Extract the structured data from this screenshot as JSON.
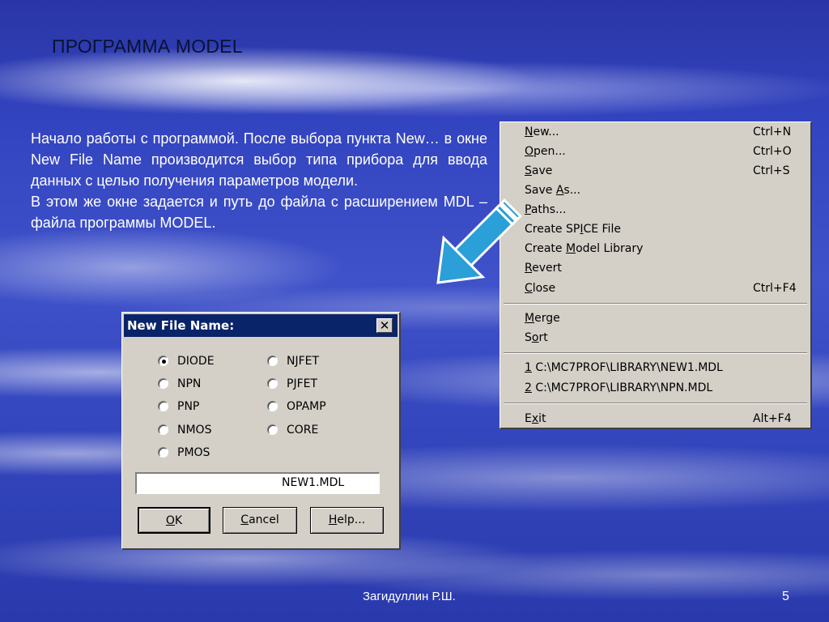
{
  "slide": {
    "title": "ПРОГРАММА MODEL",
    "paragraph1": "Начало работы с программой. После выбора пункта New… в окне New File Name производится  выбор типа  прибора для ввода данных с целью получения параметров модели.",
    "paragraph2": "В этом же окне задается и путь до файла с расширением MDL – файла программы MODEL.",
    "author": "Загидуллин Р.Ш.",
    "page_number": "5"
  },
  "menu": {
    "items": [
      {
        "pre": "",
        "u": "N",
        "post": "ew...",
        "shortcut": "Ctrl+N"
      },
      {
        "pre": "",
        "u": "O",
        "post": "pen...",
        "shortcut": "Ctrl+O"
      },
      {
        "pre": "",
        "u": "S",
        "post": "ave",
        "shortcut": "Ctrl+S"
      },
      {
        "pre": "Save ",
        "u": "A",
        "post": "s...",
        "shortcut": ""
      },
      {
        "pre": "",
        "u": "P",
        "post": "aths...",
        "shortcut": ""
      },
      {
        "pre": "Create SP",
        "u": "I",
        "post": "CE File",
        "shortcut": ""
      },
      {
        "pre": "Create ",
        "u": "M",
        "post": "odel Library",
        "shortcut": ""
      },
      {
        "pre": "",
        "u": "R",
        "post": "evert",
        "shortcut": ""
      },
      {
        "pre": "",
        "u": "C",
        "post": "lose",
        "shortcut": "Ctrl+F4"
      },
      {
        "pre": "",
        "u": "M",
        "post": "erge",
        "shortcut": ""
      },
      {
        "pre": "S",
        "u": "o",
        "post": "rt",
        "shortcut": ""
      },
      {
        "pre": "",
        "u": "1",
        "post": " C:\\MC7PROF\\LIBRARY\\NEW1.MDL",
        "shortcut": ""
      },
      {
        "pre": "",
        "u": "2",
        "post": " C:\\MC7PROF\\LIBRARY\\NPN.MDL",
        "shortcut": ""
      },
      {
        "pre": "E",
        "u": "x",
        "post": "it",
        "shortcut": "Alt+F4"
      }
    ]
  },
  "dialog": {
    "title": "New File Name:",
    "close_glyph": "✕",
    "options": [
      {
        "label": "DIODE",
        "selected": true
      },
      {
        "label": "NPN",
        "selected": false
      },
      {
        "label": "PNP",
        "selected": false
      },
      {
        "label": "NMOS",
        "selected": false
      },
      {
        "label": "PMOS",
        "selected": false
      },
      {
        "label": "NJFET",
        "selected": false
      },
      {
        "label": "PJFET",
        "selected": false
      },
      {
        "label": "OPAMP",
        "selected": false
      },
      {
        "label": "CORE",
        "selected": false
      }
    ],
    "filename_value": "NEW1.MDL",
    "buttons": {
      "ok": {
        "u": "O",
        "post": "K"
      },
      "cancel": {
        "u": "C",
        "post": "ancel"
      },
      "help": {
        "u": "H",
        "post": "elp..."
      }
    }
  },
  "colors": {
    "arrow_fill": "#2a9fd8",
    "dialog_titlebar": "#0a246a",
    "window_face": "#d4d0c8"
  }
}
